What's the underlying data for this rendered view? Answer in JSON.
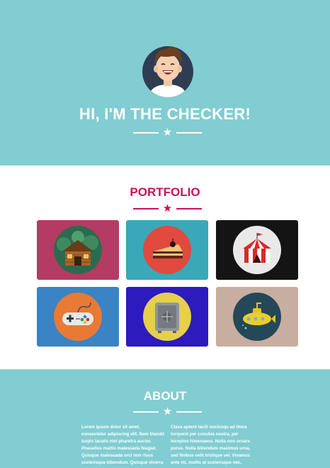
{
  "header": {
    "title": "HI, I'M THE CHECKER!"
  },
  "colors": {
    "teal": "#81cdd2",
    "white": "#ffffff",
    "accent": "#c8105a"
  },
  "portfolio": {
    "title": "PORTFOLIO",
    "items": [
      {
        "icon": "cabin-icon",
        "bg": "#b43b63",
        "circle": "#2c6a4f"
      },
      {
        "icon": "cake-icon",
        "bg": "#3aa8b8",
        "circle": "#e04a3f"
      },
      {
        "icon": "circus-tent-icon",
        "bg": "#141414",
        "circle": "#e9e9e9"
      },
      {
        "icon": "game-controller-icon",
        "bg": "#3a83c5",
        "circle": "#e87a35"
      },
      {
        "icon": "safe-icon",
        "bg": "#2c1bbd",
        "circle": "#e6cf4a"
      },
      {
        "icon": "submarine-icon",
        "bg": "#c7aea0",
        "circle": "#244858"
      }
    ]
  },
  "about": {
    "title": "ABOUT",
    "col1": "Lorem ipsum dolor sit amet, consectetur adipiscing elit. Nam blandit turpis iaculis nisl pharetra auctor. Phasellus mattis malesuada feugiat. Quisque malesuada orci non risus scelerisque bibendum. Quisque viverra vulputate posuere.",
    "col2": "Class aptent taciti sociosqu ad litora torquent per conubia nostra, per inceptos himenaeos. Nulla non ornare purus. Nulla bibendum maximus urna, sed finibus velit tristique vel. Vivamus ante mi, mollis at scelerisque nec,"
  }
}
